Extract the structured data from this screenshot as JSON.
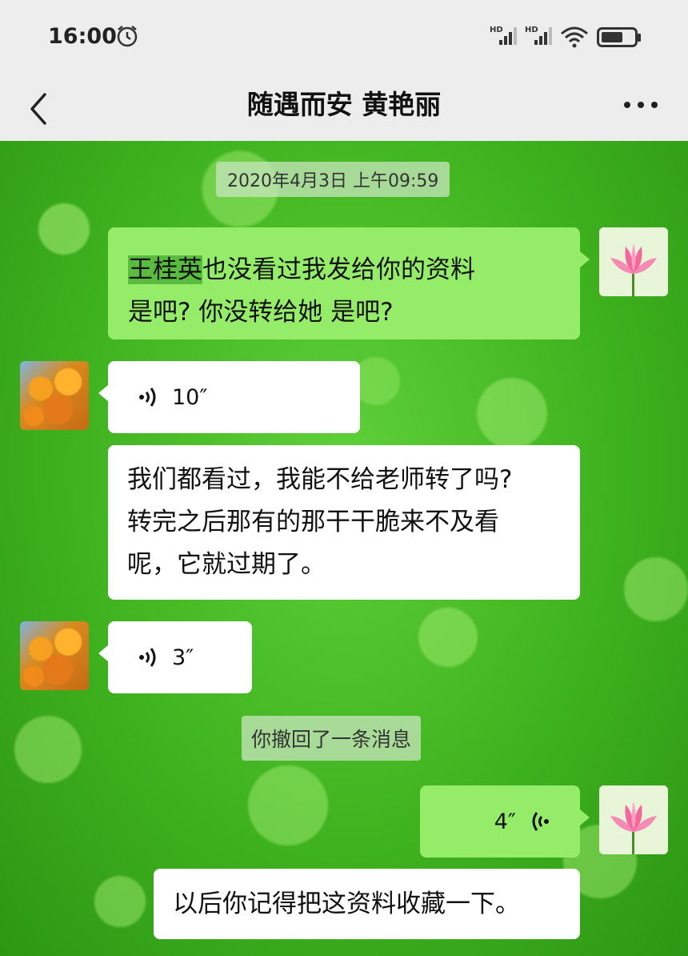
{
  "status_bar": {
    "time": "16:00"
  },
  "header": {
    "title": "随遇而安 黄艳丽"
  },
  "chat": {
    "timestamp": "2020年4月3日 上午09:59",
    "messages": [
      {
        "side": "sent",
        "highlight": "王桂英",
        "line1_rest": "也没看过我发给你的资料",
        "line2": "是吧? 你没转给她 是吧?"
      },
      {
        "side": "recv",
        "type": "voice",
        "duration": "10″"
      },
      {
        "side": "recv",
        "type": "text",
        "lines": [
          "我们都看过，我能不给老师转了吗?",
          "转完之后那有的那干干脆来不及看",
          "呢，它就过期了。"
        ]
      },
      {
        "side": "recv",
        "type": "voice",
        "duration": "3″"
      },
      {
        "side": "system",
        "text": "你撤回了一条消息"
      },
      {
        "side": "sent",
        "type": "voice",
        "duration": "4″"
      },
      {
        "side": "recv",
        "type": "text",
        "text": "以后你记得把这资料收藏一下。"
      }
    ]
  }
}
